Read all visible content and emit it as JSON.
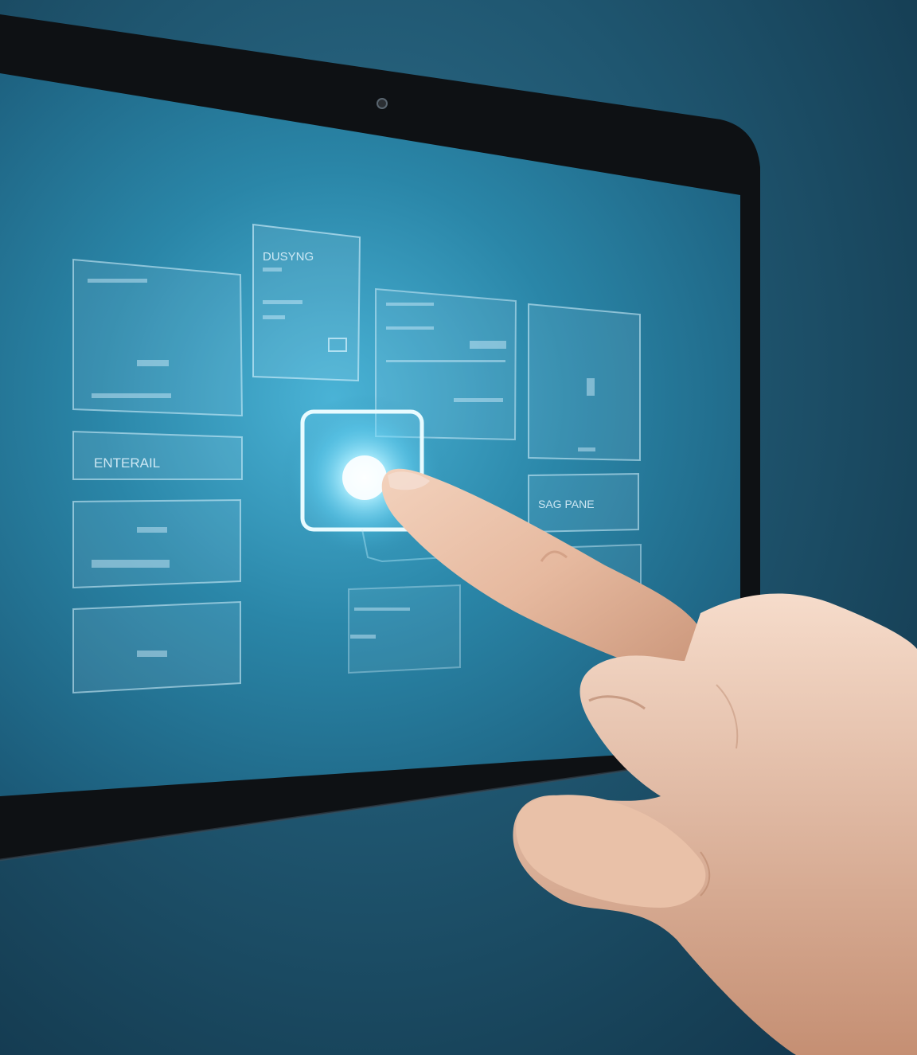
{
  "device": {
    "type": "tablet",
    "bezel_color": "#0e1114",
    "screen_color": "#2b86a8",
    "glow_color": "#8fe6ff"
  },
  "panels": {
    "top_center_title": "DUSYNG",
    "left_mid_label": "ENTERAIL",
    "right_mid_label": "SAG PANE"
  },
  "icons": {
    "pointer": "hand-pointer",
    "selected_tile": "glowing-square-button",
    "camera": "front-camera-dot"
  }
}
